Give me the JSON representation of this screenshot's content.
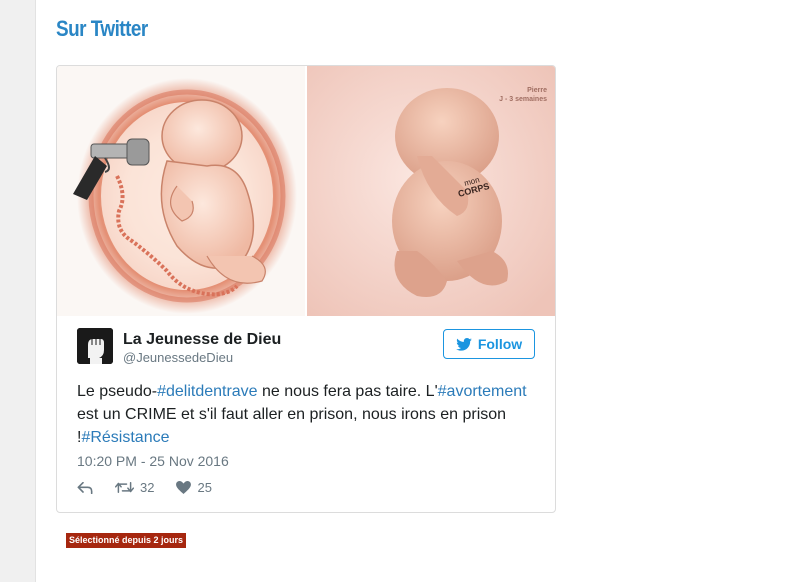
{
  "section": {
    "title": "Sur Twitter"
  },
  "tweet": {
    "media": {
      "left_image_icon": "fetus-with-revolver-illustration",
      "right_image_icon": "baby-in-fetal-position-photo",
      "right_caption_line1": "Pierre",
      "right_caption_line2": "J - 3 semaines"
    },
    "author": {
      "name": "La Jeunesse de Dieu",
      "handle": "@JeunessedeDieu",
      "avatar_icon": "raised-fist-avatar"
    },
    "follow_label": "Follow",
    "text": {
      "p1": "Le pseudo-",
      "h1": "#delitdentrave",
      "p2": " ne nous fera pas taire. L'",
      "h2": "#avortement",
      "p3": " est un CRIME et s'il faut aller en prison, nous irons en prison !",
      "h3": "#Résistance"
    },
    "timestamp": "10:20 PM - 25 Nov 2016",
    "actions": {
      "reply_icon": "reply-icon",
      "retweet_count": "32",
      "like_count": "25"
    }
  },
  "badge": {
    "label": "Sélectionné depuis 2 jours"
  },
  "colors": {
    "title_blue": "#2a86c5",
    "twitter_blue": "#1b95e0",
    "hashtag_blue": "#2b7bb9",
    "badge_red": "#a6270f"
  }
}
